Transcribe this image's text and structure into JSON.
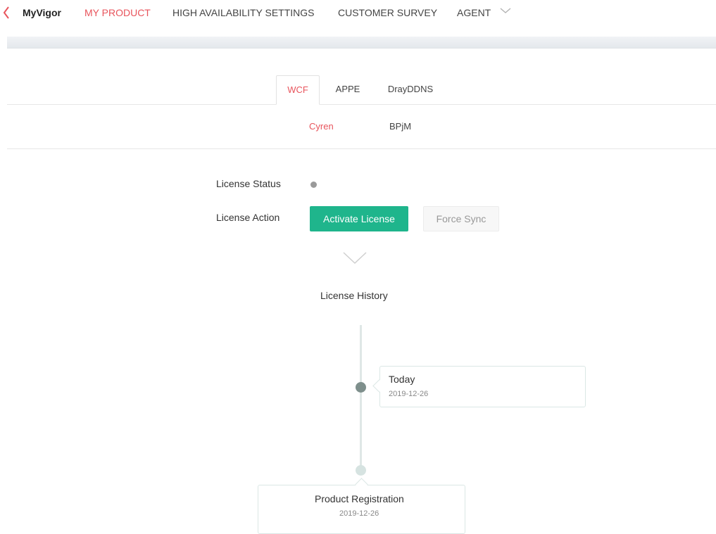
{
  "nav": {
    "brand": "MyVigor",
    "items": [
      {
        "label": "MY PRODUCT",
        "active": true
      },
      {
        "label": "HIGH AVAILABILITY SETTINGS",
        "active": false
      },
      {
        "label": "CUSTOMER SURVEY",
        "active": false
      },
      {
        "label": "AGENT",
        "active": false
      }
    ]
  },
  "tabs": [
    {
      "label": "WCF",
      "active": true
    },
    {
      "label": "APPE",
      "active": false
    },
    {
      "label": "DrayDDNS",
      "active": false
    }
  ],
  "subtabs": [
    {
      "label": "Cyren",
      "active": true
    },
    {
      "label": "BPjM",
      "active": false
    }
  ],
  "license": {
    "status_label": "License Status",
    "action_label": "License Action",
    "activate_button": "Activate License",
    "sync_button": "Force Sync"
  },
  "history": {
    "title": "License History",
    "entries": [
      {
        "title": "Today",
        "date": "2019-12-26"
      },
      {
        "title": "Product Registration",
        "date": "2019-12-26"
      }
    ]
  },
  "colors": {
    "accent": "#e8545c",
    "primary_button": "#1fb58c",
    "status_dot": "#9a9a9a"
  }
}
